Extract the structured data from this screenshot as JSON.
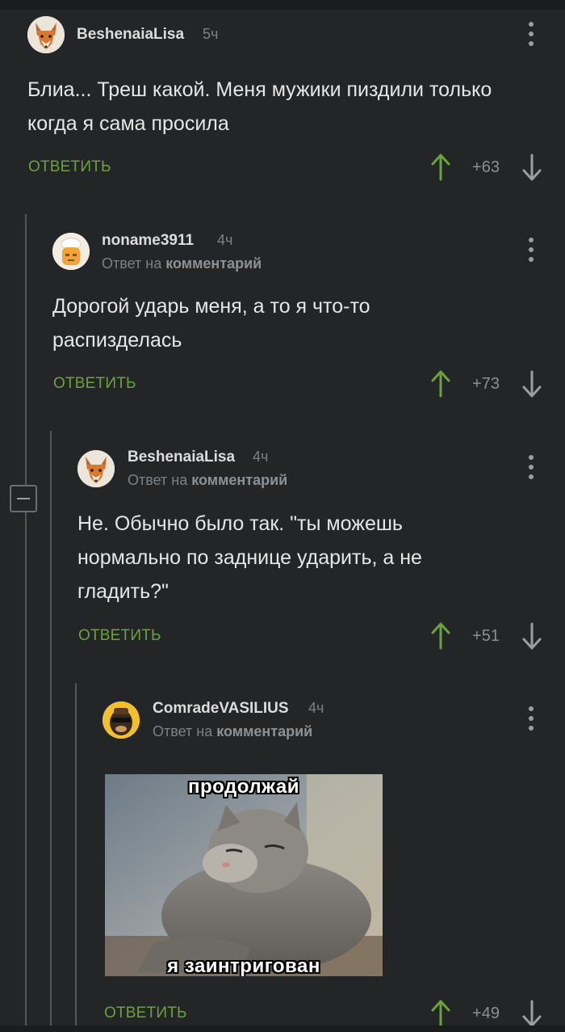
{
  "reply_to_prefix": "Ответ на",
  "reply_to_target": "комментарий",
  "reply_label": "ОТВЕТИТЬ",
  "comments": [
    {
      "author": "BeshenaiaLisa",
      "time": "5ч",
      "text": "Блиа... Треш какой. Меня мужики пиздили только когда я сама просила",
      "rating": "+63",
      "avatar": "fox-avatar"
    },
    {
      "author": "noname3911",
      "time": "4ч",
      "text": "Дорогой ударь меня, а то я что-то распизделась",
      "rating": "+73",
      "avatar": "chef-avatar"
    },
    {
      "author": "BeshenaiaLisa",
      "time": "4ч",
      "text": "Не. Обычно было так. \"ты можешь нормально по заднице ударить, а не гладить?\"",
      "rating": "+51",
      "avatar": "fox-avatar"
    },
    {
      "author": "ComradeVASILIUS",
      "time": "4ч",
      "text": "",
      "rating": "+49",
      "avatar": "cartoon-avatar",
      "image": {
        "caption_top": "продолжай",
        "caption_bottom": "я заинтригован"
      }
    }
  ],
  "colors": {
    "background": "#242526",
    "accent_green": "#6aa33e",
    "muted_text": "#7e8184"
  }
}
